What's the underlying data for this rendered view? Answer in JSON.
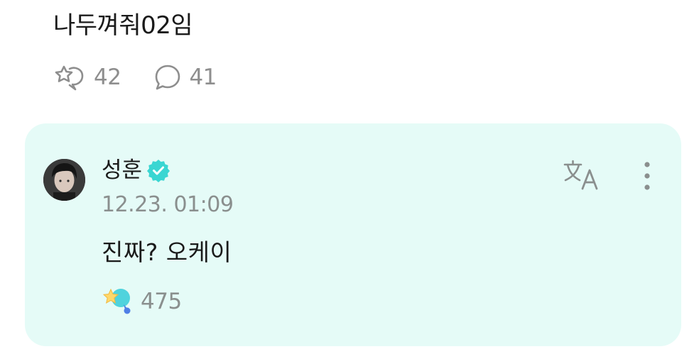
{
  "post": {
    "text": "나두껴줘02임",
    "reactions_count": "42",
    "comments_count": "41"
  },
  "reply": {
    "author": "성훈",
    "verified": true,
    "timestamp": "12.23. 01:09",
    "text": "진짜? 오케이",
    "reaction_count": "475"
  },
  "icons": {
    "reaction": "reaction-icon",
    "comment": "comment-bubble-icon",
    "verified": "verified-badge-icon",
    "translate": "translate-icon",
    "more": "more-vertical-icon",
    "artist_reaction": "artist-reaction-icon"
  },
  "colors": {
    "card_background": "#e5fbf7",
    "verified_badge": "#3ad6d2",
    "muted_text": "#8a8f8e"
  }
}
